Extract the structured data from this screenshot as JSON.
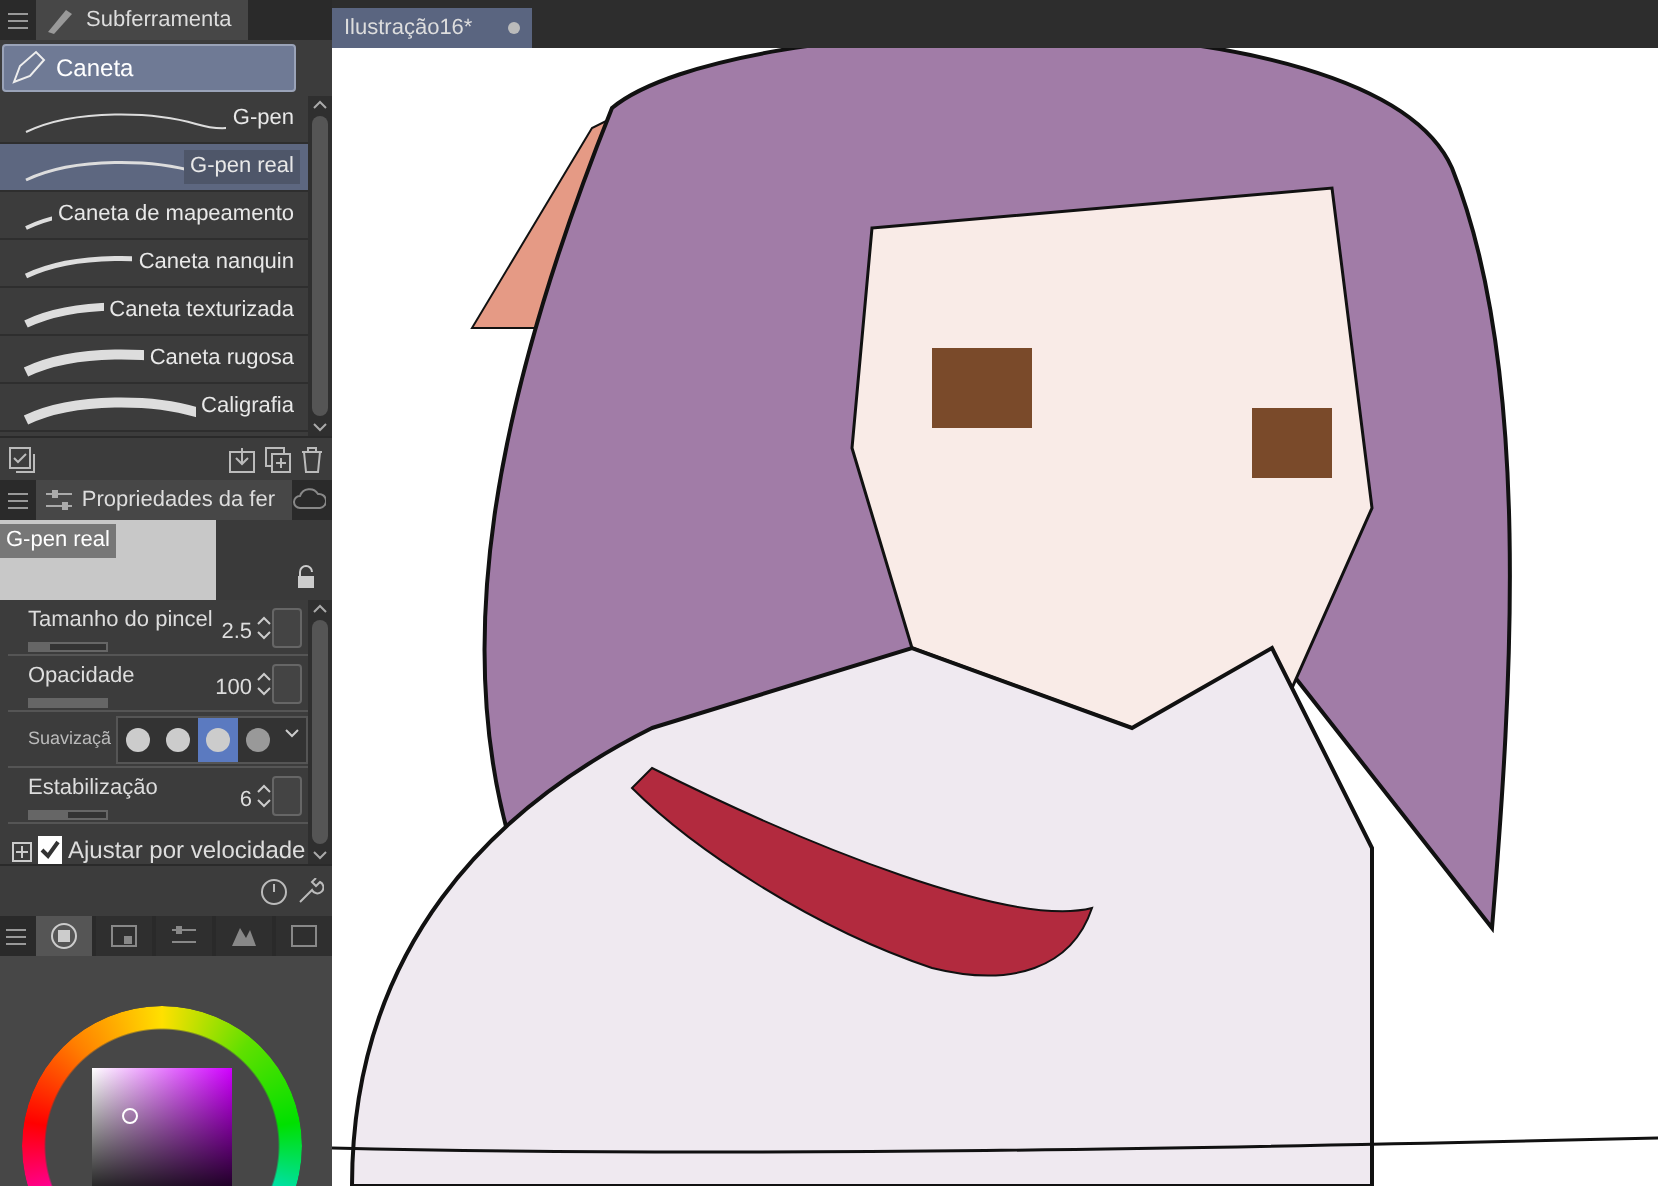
{
  "subtool_panel": {
    "tab": "Subferramenta",
    "group": "Caneta",
    "brushes": [
      {
        "label": "G-pen",
        "selected": false
      },
      {
        "label": "G-pen real",
        "selected": true
      },
      {
        "label": "Caneta de mapeamento",
        "selected": false
      },
      {
        "label": "Caneta nanquin",
        "selected": false
      },
      {
        "label": "Caneta texturizada",
        "selected": false
      },
      {
        "label": "Caneta rugosa",
        "selected": false
      },
      {
        "label": "Caligrafia",
        "selected": false
      }
    ]
  },
  "properties_panel": {
    "tab": "Propriedades da fer",
    "preview_label": "G-pen real",
    "settings": [
      {
        "kind": "slider",
        "label": "Tamanho do pincel",
        "value": "2.5",
        "level": 0.25
      },
      {
        "kind": "slider",
        "label": "Opacidade",
        "value": "100",
        "level": 1
      },
      {
        "kind": "options",
        "label": "Suavizaçã",
        "options": [
          {
            "selected": false
          },
          {
            "selected": false
          },
          {
            "selected": true
          },
          {
            "selected": false
          }
        ]
      },
      {
        "kind": "slider",
        "label": "Estabilização",
        "value": "6",
        "level": 0.5
      },
      {
        "kind": "checkbox",
        "label": "Ajustar por velocidade",
        "checked": true
      }
    ]
  },
  "color_panel": {
    "tabs": [
      {
        "selected": true
      },
      {
        "selected": false
      },
      {
        "selected": false
      },
      {
        "selected": false
      },
      {
        "selected": false
      }
    ]
  },
  "document_tab": {
    "title": "Ilustração16*"
  }
}
